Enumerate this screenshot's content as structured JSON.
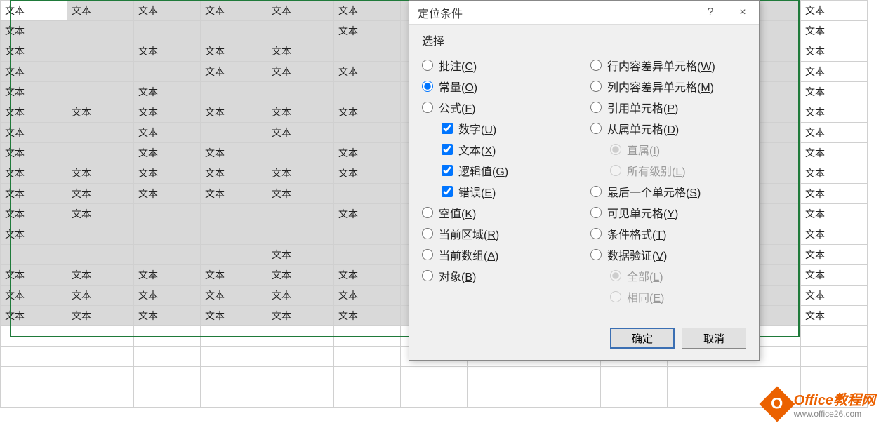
{
  "cell_text": "文本",
  "grid": {
    "cols": 13,
    "rows": 20,
    "filled": [
      [
        1,
        1,
        1,
        1,
        1,
        1,
        0,
        0,
        0,
        0,
        0,
        1,
        1
      ],
      [
        1,
        0,
        0,
        0,
        0,
        1,
        0,
        0,
        0,
        0,
        0,
        1,
        1
      ],
      [
        1,
        0,
        1,
        1,
        1,
        0,
        0,
        0,
        0,
        0,
        0,
        1,
        1
      ],
      [
        1,
        0,
        0,
        1,
        1,
        1,
        0,
        0,
        0,
        0,
        0,
        1,
        1
      ],
      [
        1,
        0,
        1,
        0,
        0,
        0,
        0,
        0,
        0,
        0,
        0,
        1,
        1
      ],
      [
        1,
        1,
        1,
        1,
        1,
        1,
        0,
        0,
        0,
        0,
        0,
        1,
        1
      ],
      [
        1,
        0,
        1,
        0,
        1,
        0,
        0,
        0,
        0,
        0,
        0,
        1,
        1
      ],
      [
        1,
        0,
        1,
        1,
        0,
        1,
        0,
        0,
        0,
        0,
        0,
        1,
        1
      ],
      [
        1,
        1,
        1,
        1,
        1,
        1,
        0,
        0,
        0,
        0,
        0,
        1,
        1
      ],
      [
        1,
        1,
        1,
        1,
        1,
        0,
        0,
        0,
        0,
        0,
        0,
        1,
        1
      ],
      [
        1,
        1,
        0,
        0,
        0,
        1,
        0,
        0,
        0,
        0,
        0,
        1,
        1
      ],
      [
        1,
        0,
        0,
        0,
        0,
        0,
        0,
        0,
        0,
        0,
        0,
        1,
        1
      ],
      [
        0,
        0,
        0,
        0,
        1,
        0,
        0,
        0,
        0,
        0,
        0,
        1,
        1
      ],
      [
        1,
        1,
        1,
        1,
        1,
        1,
        0,
        0,
        0,
        0,
        0,
        1,
        1
      ],
      [
        1,
        1,
        1,
        1,
        1,
        1,
        0,
        0,
        0,
        0,
        0,
        1,
        1
      ],
      [
        1,
        1,
        1,
        1,
        1,
        1,
        0,
        0,
        0,
        0,
        0,
        1,
        1
      ],
      [
        0,
        0,
        0,
        0,
        0,
        0,
        0,
        0,
        0,
        0,
        0,
        0,
        0
      ],
      [
        0,
        0,
        0,
        0,
        0,
        0,
        0,
        0,
        0,
        0,
        0,
        0,
        0
      ],
      [
        0,
        0,
        0,
        0,
        0,
        0,
        0,
        0,
        0,
        0,
        0,
        0,
        0
      ],
      [
        0,
        0,
        0,
        0,
        0,
        0,
        0,
        0,
        0,
        0,
        0,
        0,
        0
      ]
    ],
    "selection_rows": 16,
    "selection_cols": 12
  },
  "dialog": {
    "title": "定位条件",
    "help": "?",
    "close": "×",
    "group_label": "选择",
    "left_options": [
      {
        "type": "radio",
        "label": "批注",
        "key": "C",
        "checked": false
      },
      {
        "type": "radio",
        "label": "常量",
        "key": "O",
        "checked": true
      },
      {
        "type": "radio",
        "label": "公式",
        "key": "F",
        "checked": false
      },
      {
        "type": "checkbox",
        "label": "数字",
        "key": "U",
        "checked": true,
        "indent": true
      },
      {
        "type": "checkbox",
        "label": "文本",
        "key": "X",
        "checked": true,
        "indent": true
      },
      {
        "type": "checkbox",
        "label": "逻辑值",
        "key": "G",
        "checked": true,
        "indent": true
      },
      {
        "type": "checkbox",
        "label": "错误",
        "key": "E",
        "checked": true,
        "indent": true
      },
      {
        "type": "radio",
        "label": "空值",
        "key": "K",
        "checked": false
      },
      {
        "type": "radio",
        "label": "当前区域",
        "key": "R",
        "checked": false
      },
      {
        "type": "radio",
        "label": "当前数组",
        "key": "A",
        "checked": false
      },
      {
        "type": "radio",
        "label": "对象",
        "key": "B",
        "checked": false
      }
    ],
    "right_options": [
      {
        "type": "radio",
        "label": "行内容差异单元格",
        "key": "W",
        "checked": false
      },
      {
        "type": "radio",
        "label": "列内容差异单元格",
        "key": "M",
        "checked": false
      },
      {
        "type": "radio",
        "label": "引用单元格",
        "key": "P",
        "checked": false
      },
      {
        "type": "radio",
        "label": "从属单元格",
        "key": "D",
        "checked": false
      },
      {
        "type": "radio",
        "label": "直属",
        "key": "I",
        "checked": true,
        "indent": true,
        "disabled": true
      },
      {
        "type": "radio",
        "label": "所有级别",
        "key": "L",
        "checked": false,
        "indent": true,
        "disabled": true
      },
      {
        "type": "radio",
        "label": "最后一个单元格",
        "key": "S",
        "checked": false
      },
      {
        "type": "radio",
        "label": "可见单元格",
        "key": "Y",
        "checked": false
      },
      {
        "type": "radio",
        "label": "条件格式",
        "key": "T",
        "checked": false
      },
      {
        "type": "radio",
        "label": "数据验证",
        "key": "V",
        "checked": false
      },
      {
        "type": "radio",
        "label": "全部",
        "key": "L",
        "checked": true,
        "indent": true,
        "disabled": true
      },
      {
        "type": "radio",
        "label": "相同",
        "key": "E",
        "checked": false,
        "indent": true,
        "disabled": true
      }
    ],
    "ok": "确定",
    "cancel": "取消"
  },
  "watermark": {
    "logo": "O",
    "brand_en": "Office",
    "brand_cn": "教程网",
    "url": "www.office26.com"
  }
}
